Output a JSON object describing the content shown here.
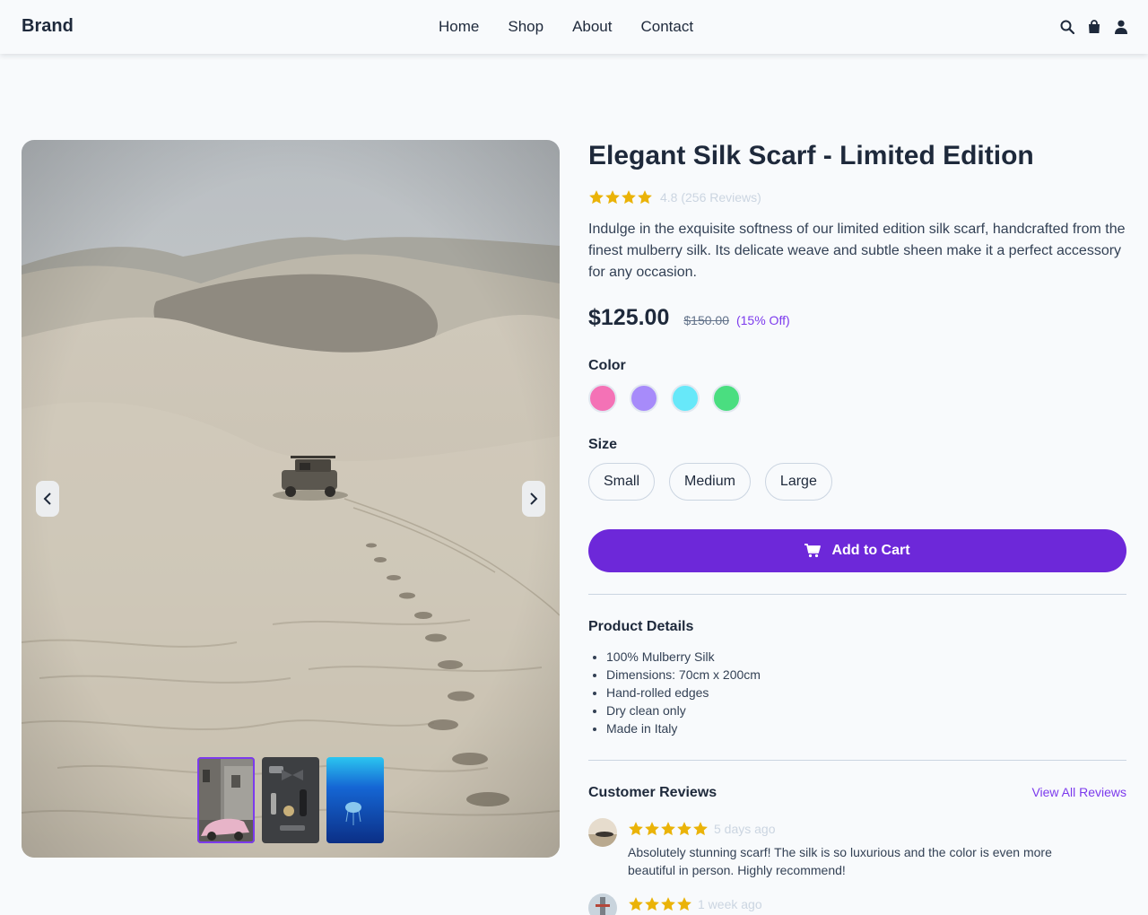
{
  "header": {
    "brand": "Brand",
    "nav": [
      "Home",
      "Shop",
      "About",
      "Contact"
    ],
    "icons": [
      "search-icon",
      "shopping-bag-icon",
      "user-icon"
    ]
  },
  "gallery": {
    "main_image": "desert sand dunes with an off-road vehicle",
    "thumbnails": [
      "street scene with pink car",
      "flat-lay of accessories",
      "jellyfish in blue water"
    ],
    "active_thumbnail": 0,
    "icons": [
      "chevron-left-icon",
      "chevron-right-icon"
    ]
  },
  "product": {
    "title": "Elegant Silk Scarf - Limited Edition",
    "rating": 4.8,
    "rating_text": "4.8 (256 Reviews)",
    "description": "Indulge in the exquisite softness of our limited edition silk scarf, handcrafted from the finest mulberry silk. Its delicate weave and subtle sheen make it a perfect accessory for any occasion.",
    "price": "$125.00",
    "old_price": "$150.00",
    "discount": "(15% Off)",
    "color_label": "Color",
    "colors": [
      "#f472b6",
      "#a78bfa",
      "#67e8f9",
      "#4ade80"
    ],
    "size_label": "Size",
    "sizes": [
      "Small",
      "Medium",
      "Large"
    ],
    "cart_label": "Add to Cart"
  },
  "details": {
    "title": "Product Details",
    "items": [
      "100% Mulberry Silk",
      "Dimensions: 70cm x 200cm",
      "Hand-rolled edges",
      "Dry clean only",
      "Made in Italy"
    ]
  },
  "reviews": {
    "title": "Customer Reviews",
    "view_all": "View All Reviews",
    "items": [
      {
        "stars": 5,
        "date": "5 days ago",
        "text": "Absolutely stunning scarf! The silk is so luxurious and the color is even more beautiful in person. Highly recommend!"
      },
      {
        "stars": 4,
        "date": "1 week ago",
        "text": ""
      }
    ]
  },
  "colors": {
    "accent": "#6d28d9",
    "star": "#eab308",
    "text": "#1e293b",
    "muted": "#cbd5e1"
  }
}
